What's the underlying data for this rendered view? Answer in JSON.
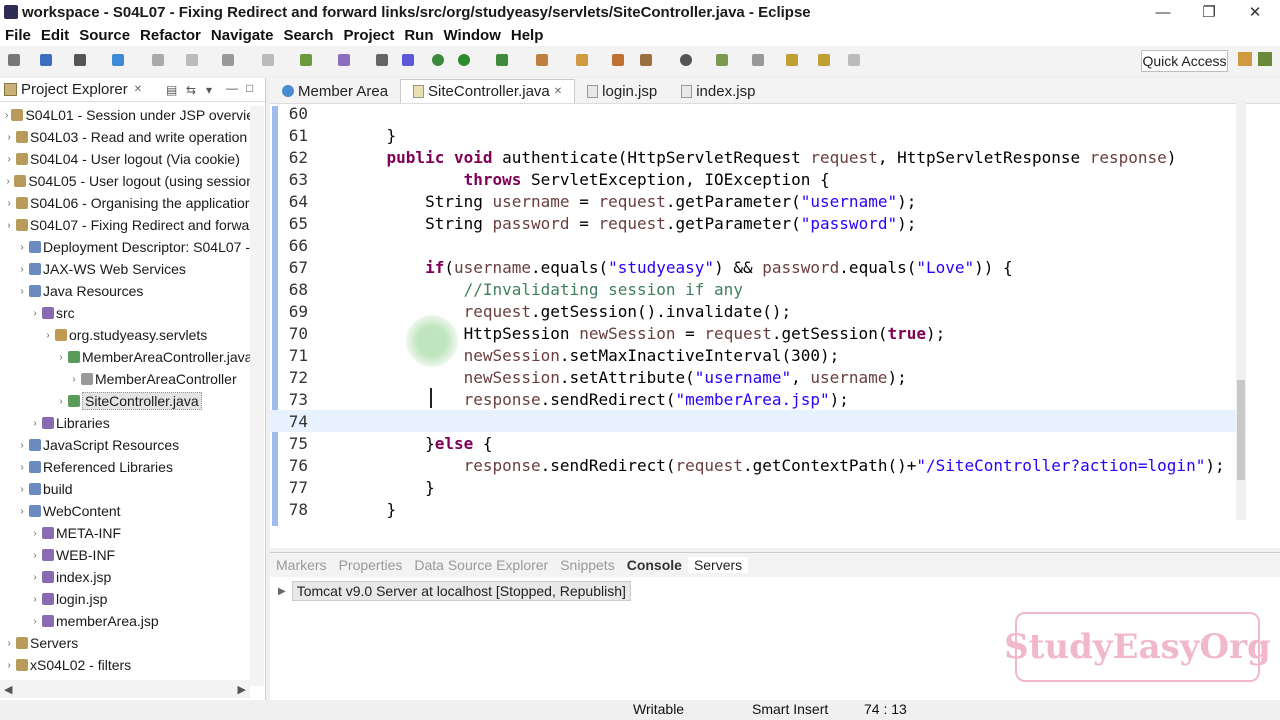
{
  "window": {
    "title": "workspace - S04L07 - Fixing Redirect and forward links/src/org/studyeasy/servlets/SiteController.java - Eclipse"
  },
  "menu": [
    "File",
    "Edit",
    "Source",
    "Refactor",
    "Navigate",
    "Search",
    "Project",
    "Run",
    "Window",
    "Help"
  ],
  "quick_access": "Quick Access",
  "project_explorer": {
    "title": "Project Explorer",
    "items": [
      {
        "label": "S04L01 - Session under JSP overvie",
        "indent": 0
      },
      {
        "label": "S04L03 - Read and write operation",
        "indent": 0
      },
      {
        "label": "S04L04 - User logout (Via cookie)",
        "indent": 0
      },
      {
        "label": "S04L05 - User logout (using session",
        "indent": 0
      },
      {
        "label": "S04L06 - Organising the applicatior",
        "indent": 0
      },
      {
        "label": "S04L07 - Fixing Redirect and forwar",
        "indent": 0
      },
      {
        "label": "Deployment Descriptor: S04L07 -",
        "indent": 1
      },
      {
        "label": "JAX-WS Web Services",
        "indent": 1
      },
      {
        "label": "Java Resources",
        "indent": 1
      },
      {
        "label": "src",
        "indent": 2
      },
      {
        "label": "org.studyeasy.servlets",
        "indent": 3
      },
      {
        "label": "MemberAreaController.java",
        "indent": 4
      },
      {
        "label": "MemberAreaController",
        "indent": 5
      },
      {
        "label": "SiteController.java",
        "indent": 4
      },
      {
        "label": "Libraries",
        "indent": 2
      },
      {
        "label": "JavaScript Resources",
        "indent": 1
      },
      {
        "label": "Referenced Libraries",
        "indent": 1
      },
      {
        "label": "build",
        "indent": 1
      },
      {
        "label": "WebContent",
        "indent": 1
      },
      {
        "label": "META-INF",
        "indent": 2
      },
      {
        "label": "WEB-INF",
        "indent": 2
      },
      {
        "label": "index.jsp",
        "indent": 2
      },
      {
        "label": "login.jsp",
        "indent": 2
      },
      {
        "label": "memberArea.jsp",
        "indent": 2
      },
      {
        "label": "Servers",
        "indent": 0
      },
      {
        "label": "xS04L02 - filters",
        "indent": 0
      }
    ]
  },
  "editor": {
    "tabs": [
      "Member Area",
      "SiteController.java",
      "login.jsp",
      "index.jsp"
    ],
    "lines": [
      {
        "n": "60",
        "code": ""
      },
      {
        "n": "61",
        "code": "    }"
      },
      {
        "n": "62",
        "code": "    public void authenticate(HttpServletRequest request, HttpServletResponse response)"
      },
      {
        "n": "63",
        "code": "            throws ServletException, IOException {"
      },
      {
        "n": "64",
        "code": "        String username = request.getParameter(\"username\");"
      },
      {
        "n": "65",
        "code": "        String password = request.getParameter(\"password\");"
      },
      {
        "n": "66",
        "code": ""
      },
      {
        "n": "67",
        "code": "        if(username.equals(\"studyeasy\") && password.equals(\"Love\")) {"
      },
      {
        "n": "68",
        "code": "            //Invalidating session if any"
      },
      {
        "n": "69",
        "code": "            request.getSession().invalidate();"
      },
      {
        "n": "70",
        "code": "            HttpSession newSession = request.getSession(true);"
      },
      {
        "n": "71",
        "code": "            newSession.setMaxInactiveInterval(300);"
      },
      {
        "n": "72",
        "code": "            newSession.setAttribute(\"username\", username);"
      },
      {
        "n": "73",
        "code": "            response.sendRedirect(\"memberArea.jsp\");"
      },
      {
        "n": "74",
        "code": ""
      },
      {
        "n": "75",
        "code": "        }else {"
      },
      {
        "n": "76",
        "code": "            response.sendRedirect(request.getContextPath()+\"/SiteController?action=login\");"
      },
      {
        "n": "77",
        "code": "        }"
      },
      {
        "n": "78",
        "code": "    }"
      }
    ]
  },
  "bottom_panel": {
    "tabs": [
      "Markers",
      "Properties",
      "Data Source Explorer",
      "Snippets",
      "Console",
      "Servers"
    ],
    "server": "Tomcat v9.0 Server at localhost  [Stopped, Republish]"
  },
  "status_bar": {
    "writable": "Writable",
    "insert_mode": "Smart Insert",
    "position": "74 : 13"
  },
  "watermark": "StudyEasyOrg"
}
